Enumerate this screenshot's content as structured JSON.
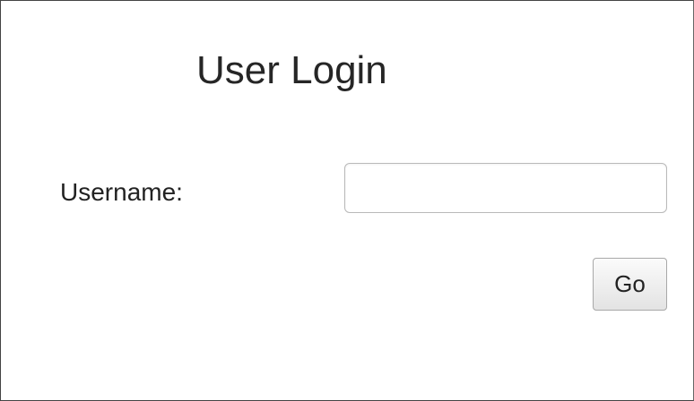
{
  "login": {
    "title": "User Login",
    "username_label": "Username:",
    "username_value": "",
    "username_placeholder": "",
    "submit_label": "Go"
  }
}
